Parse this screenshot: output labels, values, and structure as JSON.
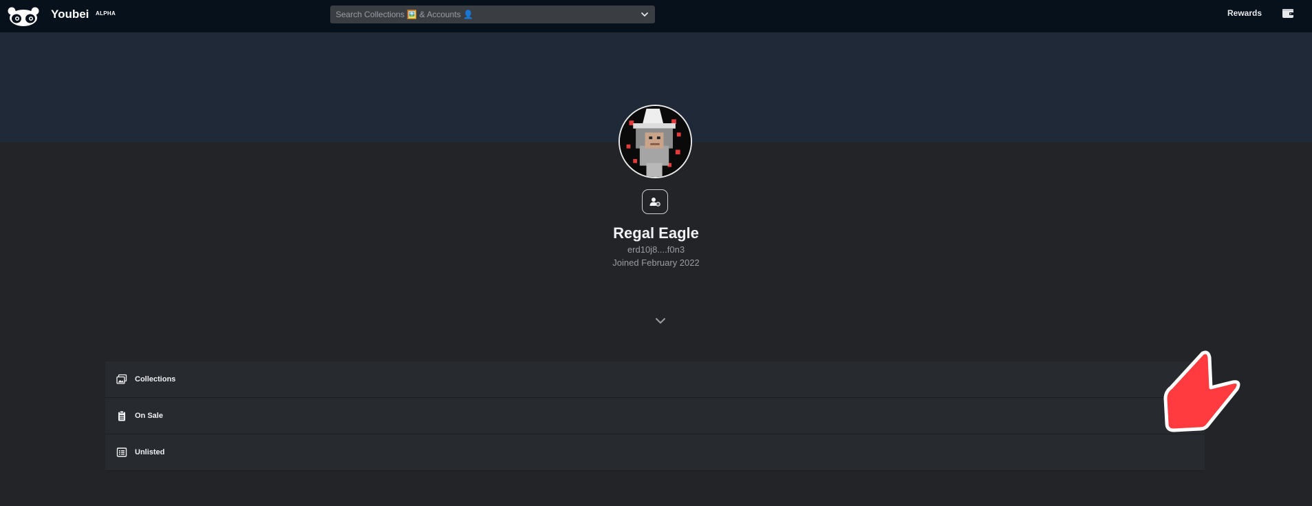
{
  "header": {
    "brand": "Youbei",
    "brand_tag": "ALPHA",
    "search_placeholder": "Search Collections 🖼️ & Accounts 👤",
    "rewards_label": "Rewards",
    "logo_icon": "panda-logo-icon",
    "wallet_icon": "wallet-icon"
  },
  "profile": {
    "name": "Regal Eagle",
    "address": "erd10j8....f0n3",
    "joined": "Joined February 2022",
    "avatar": "pixel-wizard-avatar",
    "settings_icon": "user-settings-icon"
  },
  "sections": [
    {
      "label": "Collections",
      "icon": "images-icon"
    },
    {
      "label": "On Sale",
      "icon": "clipboard-icon"
    },
    {
      "label": "Unlisted",
      "icon": "list-icon"
    }
  ],
  "colors": {
    "topbar": "#07111c",
    "banner": "#1f2938",
    "page_bg": "#222427",
    "row_bg": "#272a2f",
    "pointer": "#ff3b3f"
  }
}
